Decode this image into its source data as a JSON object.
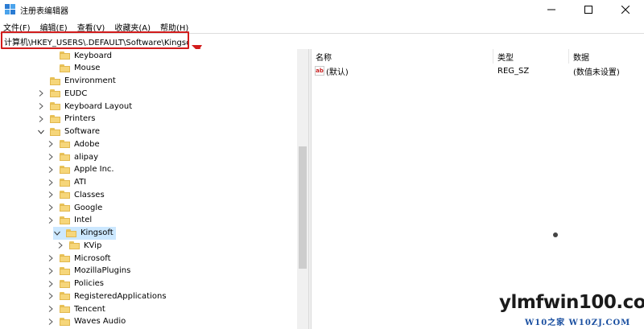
{
  "window": {
    "title": "注册表编辑器",
    "controls": {
      "minimize": "minimize-icon",
      "maximize": "maximize-icon",
      "close": "close-icon"
    }
  },
  "menu": [
    {
      "label": "文件(F)"
    },
    {
      "label": "编辑(E)"
    },
    {
      "label": "查看(V)"
    },
    {
      "label": "收藏夹(A)"
    },
    {
      "label": "帮助(H)"
    }
  ],
  "address": {
    "value": "计算机\\HKEY_USERS\\.DEFAULT\\Software\\Kingsoft"
  },
  "tree": {
    "items": [
      {
        "label": "Keyboard",
        "depth": 2,
        "expander": "none"
      },
      {
        "label": "Mouse",
        "depth": 2,
        "expander": "none"
      },
      {
        "label": "Environment",
        "depth": 1,
        "expander": "none"
      },
      {
        "label": "EUDC",
        "depth": 1,
        "expander": "collapsed"
      },
      {
        "label": "Keyboard Layout",
        "depth": 1,
        "expander": "collapsed"
      },
      {
        "label": "Printers",
        "depth": 1,
        "expander": "collapsed"
      },
      {
        "label": "Software",
        "depth": 1,
        "expander": "expanded"
      },
      {
        "label": "Adobe",
        "depth": 2,
        "expander": "collapsed"
      },
      {
        "label": "alipay",
        "depth": 2,
        "expander": "collapsed"
      },
      {
        "label": "Apple Inc.",
        "depth": 2,
        "expander": "collapsed"
      },
      {
        "label": "ATI",
        "depth": 2,
        "expander": "collapsed"
      },
      {
        "label": "Classes",
        "depth": 2,
        "expander": "collapsed"
      },
      {
        "label": "Google",
        "depth": 2,
        "expander": "collapsed"
      },
      {
        "label": "Intel",
        "depth": 2,
        "expander": "collapsed"
      },
      {
        "label": "Kingsoft",
        "depth": 2,
        "expander": "expanded",
        "selected": true
      },
      {
        "label": "KVip",
        "depth": 3,
        "expander": "collapsed"
      },
      {
        "label": "Microsoft",
        "depth": 2,
        "expander": "collapsed"
      },
      {
        "label": "MozillaPlugins",
        "depth": 2,
        "expander": "collapsed"
      },
      {
        "label": "Policies",
        "depth": 2,
        "expander": "collapsed"
      },
      {
        "label": "RegisteredApplications",
        "depth": 2,
        "expander": "collapsed"
      },
      {
        "label": "Tencent",
        "depth": 2,
        "expander": "collapsed"
      },
      {
        "label": "Waves Audio",
        "depth": 2,
        "expander": "collapsed"
      }
    ]
  },
  "list": {
    "columns": {
      "name": "名称",
      "type": "类型",
      "data": "数据"
    },
    "rows": [
      {
        "icon": "ab",
        "name": "(默认)",
        "type": "REG_SZ",
        "data": "(数值未设置)"
      }
    ]
  },
  "watermark": {
    "main": "ylmfwin100.com",
    "sub": "W10之家 W10ZJ.COM"
  },
  "colors": {
    "highlight_box": "#d21c1c",
    "selected_row": "#cce8ff",
    "folder": "#f6d67a"
  }
}
